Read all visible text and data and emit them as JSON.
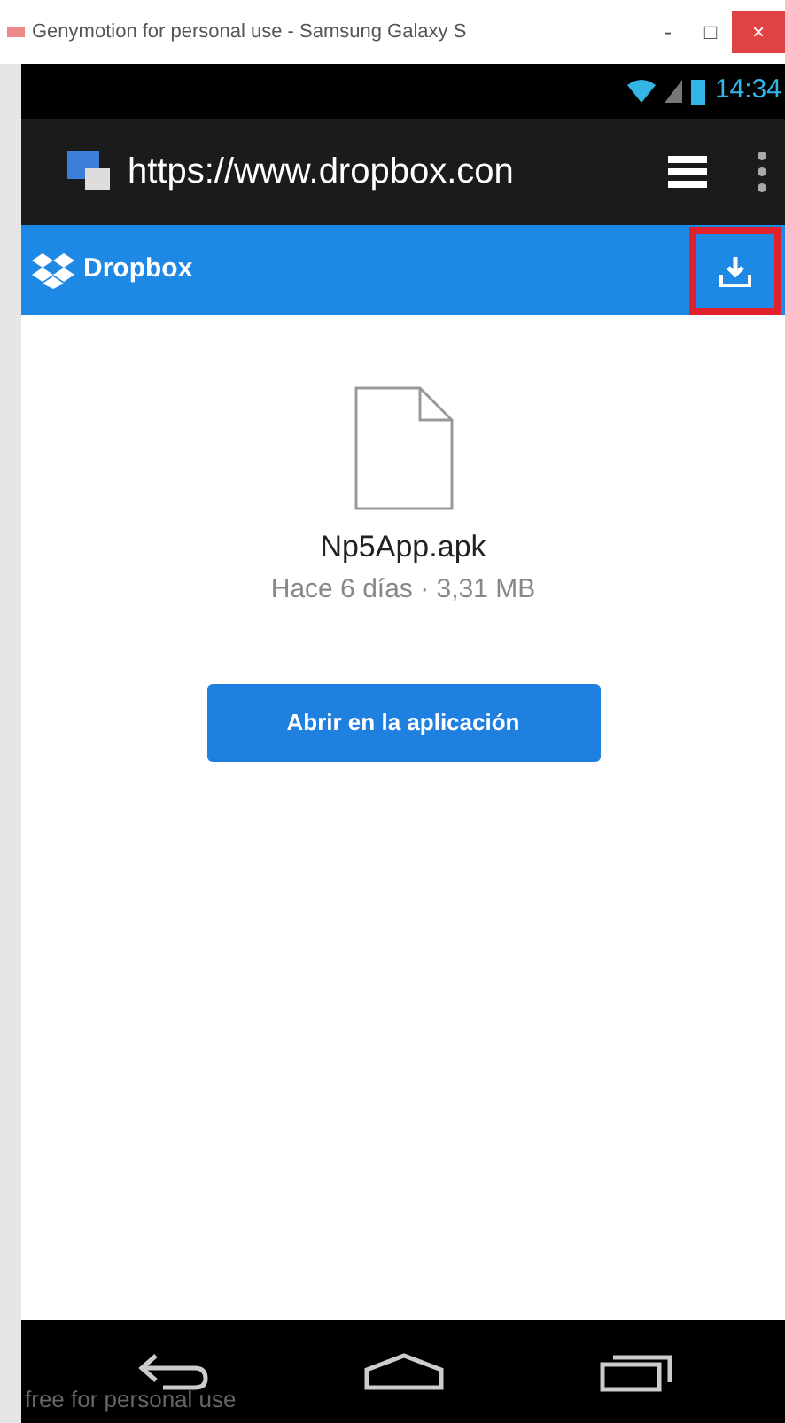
{
  "window": {
    "title": "Genymotion for personal use - Samsung Galaxy S",
    "controls": [
      "-",
      "□",
      "×"
    ]
  },
  "status_bar": {
    "time": "14:34"
  },
  "browser": {
    "url": "https://www.dropbox.con"
  },
  "header": {
    "brand": "Dropbox",
    "download_highlighted": true
  },
  "file": {
    "name": "Np5App.apk",
    "meta": "Hace 6 días · 3,31 MB"
  },
  "open_button": "Abrir en la aplicación",
  "nav_bar": {
    "watermark_text": "free for personal use"
  }
}
